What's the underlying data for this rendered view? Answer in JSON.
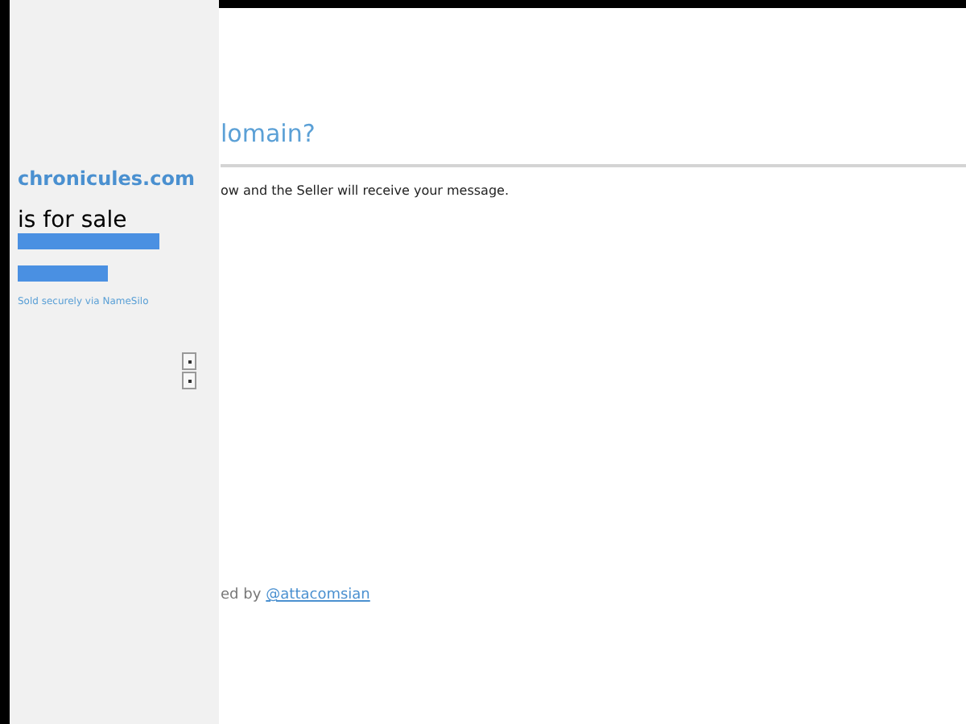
{
  "main": {
    "heading": "lomain?",
    "message": "ow and the Seller will receive your message.",
    "footer_text": "ed by",
    "footer_link": "@attacomsian"
  },
  "sidebar": {
    "domain": "chronicules.com",
    "tagline": "is for sale",
    "bars": [
      {
        "kind": "wide"
      },
      {
        "kind": "narrow"
      }
    ],
    "note": "Sold securely via NameSilo",
    "buttons": [
      {
        "kind": "dot"
      },
      {
        "kind": "dot"
      }
    ]
  }
}
